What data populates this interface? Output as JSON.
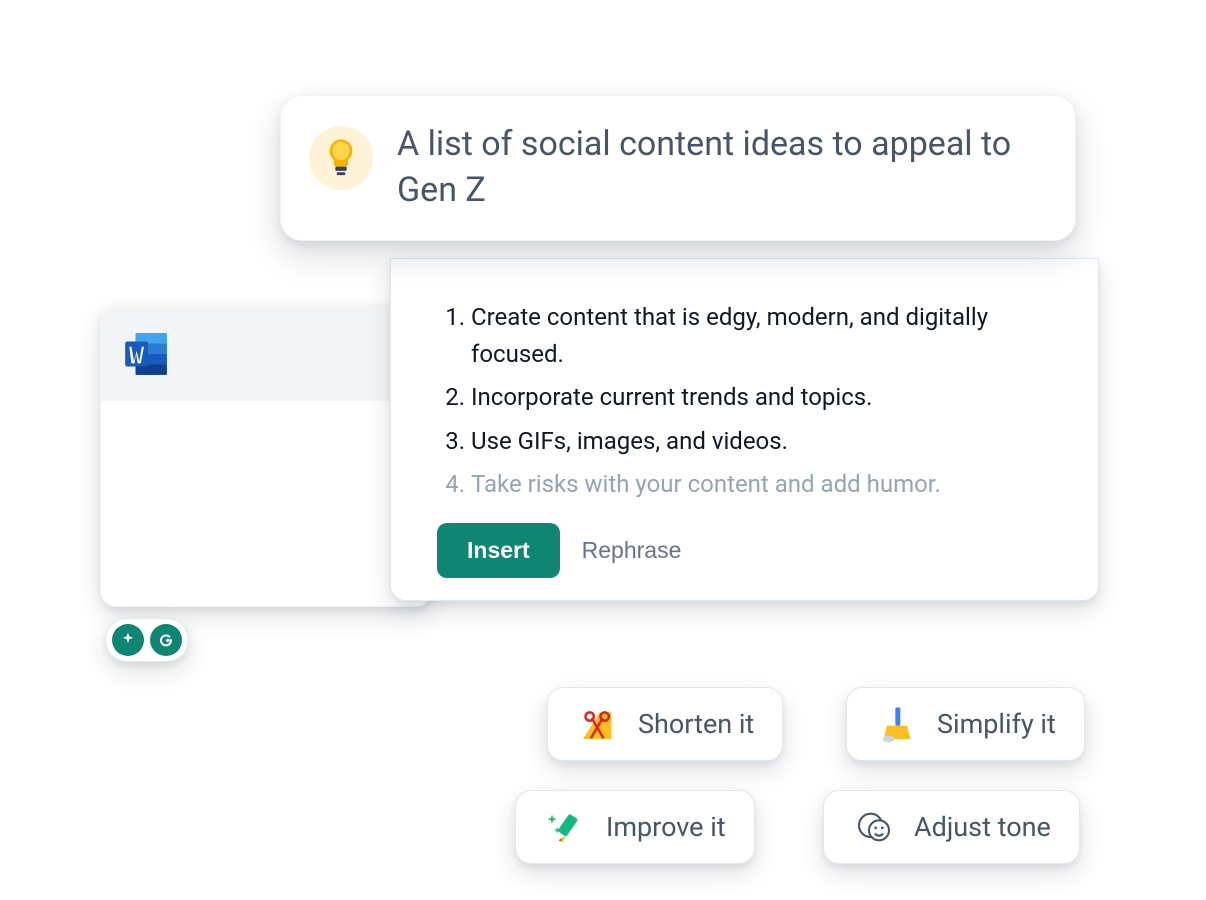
{
  "prompt": {
    "text": "A list of social content ideas to appeal to Gen Z"
  },
  "results": {
    "items": [
      "Create content that is edgy, modern, and digitally focused.",
      "Incorporate current trends and topics.",
      "Use GIFs, images, and videos.",
      "Take risks with your content and add humor."
    ],
    "faded_index": 3
  },
  "actions": {
    "insert": "Insert",
    "rephrase": "Rephrase"
  },
  "chips": {
    "shorten": "Shorten it",
    "simplify": "Simplify it",
    "improve": "Improve it",
    "adjust": "Adjust tone"
  },
  "icons": {
    "word": "word-app-icon",
    "bulb": "lightbulb-icon",
    "sparkle": "sparkle-icon",
    "grammarly": "grammarly-g-icon",
    "scissors": "scissors-icon",
    "broom": "broom-icon",
    "pencil": "sparkle-pencil-icon",
    "smiley": "smiley-icon"
  },
  "colors": {
    "accent": "#0f8573",
    "bulb_bg": "#fef3d7",
    "word_dark": "#1b5cbe",
    "word_light": "#2b7cd3"
  }
}
